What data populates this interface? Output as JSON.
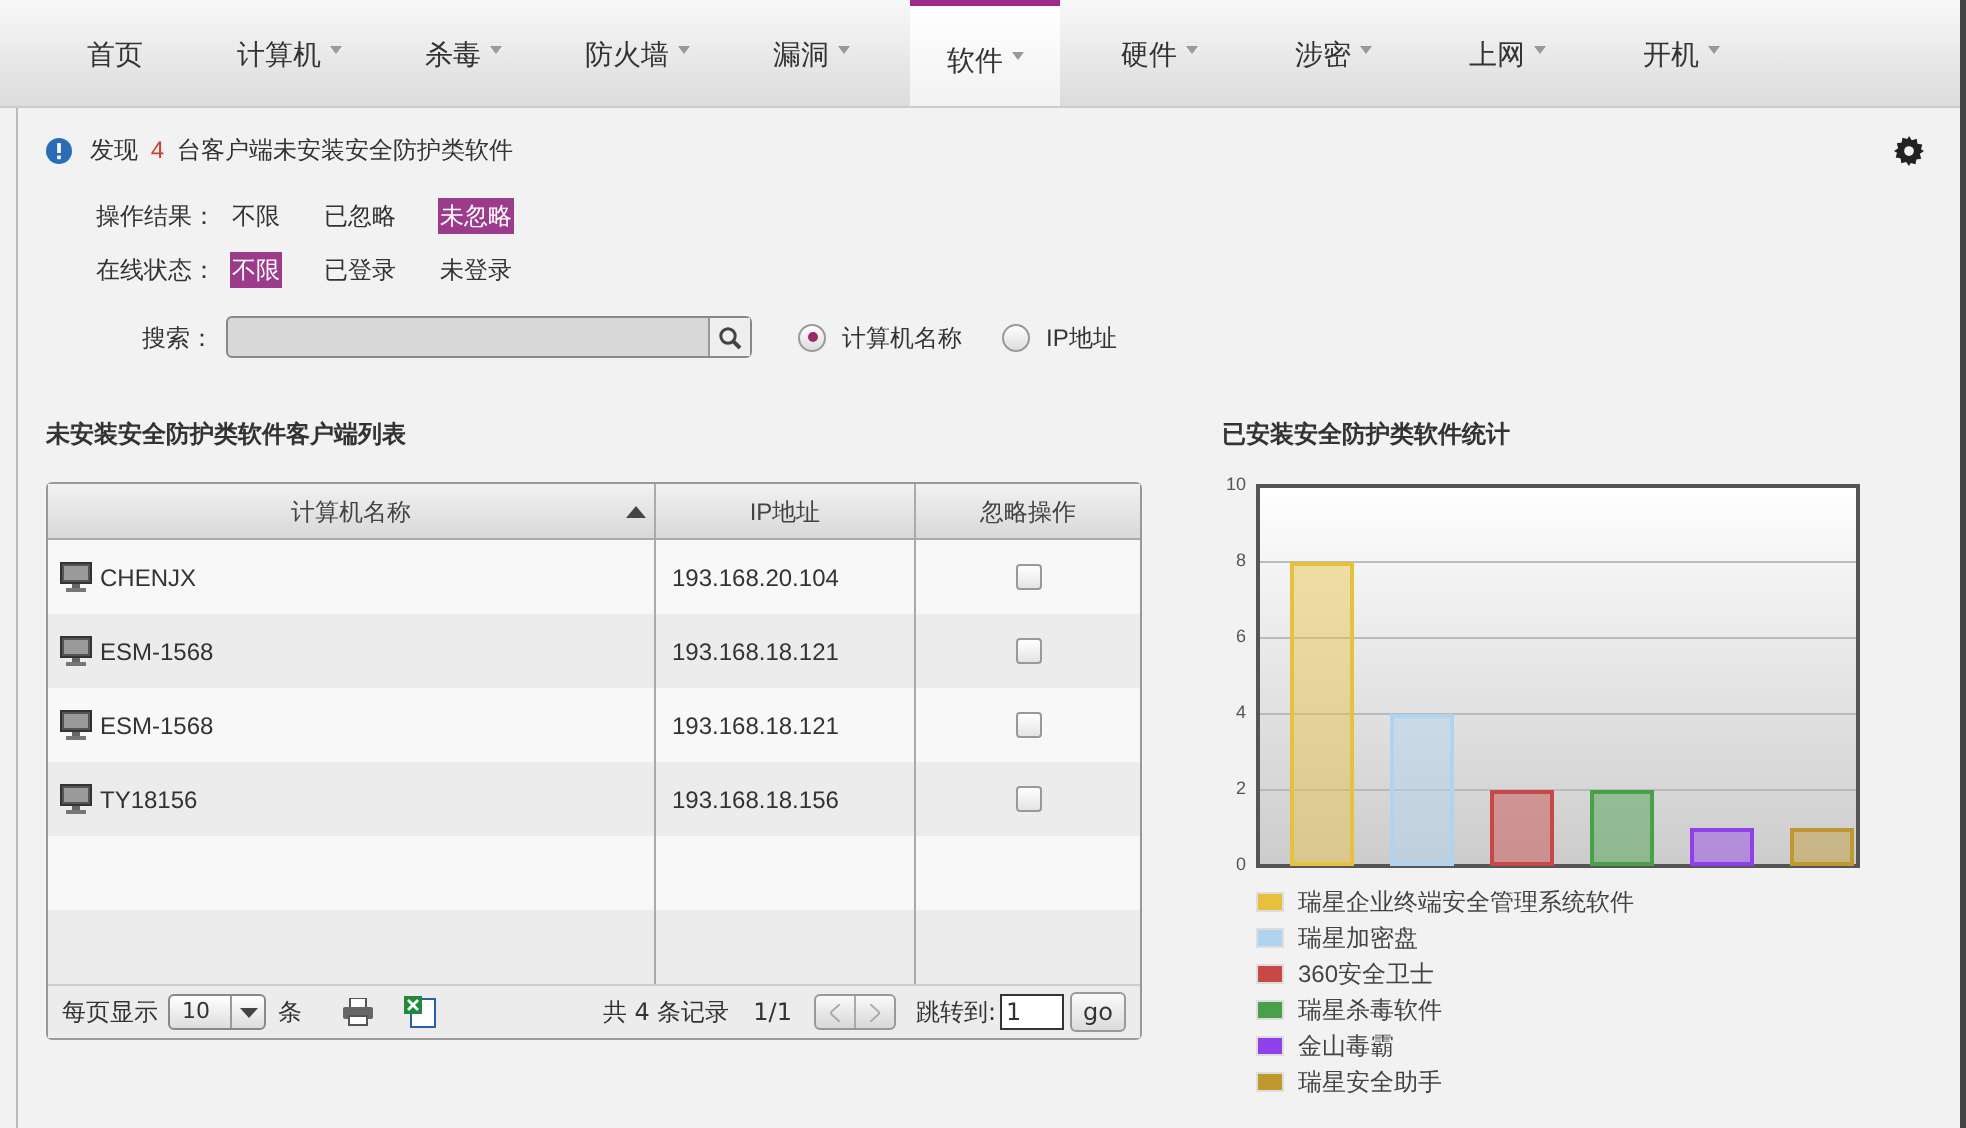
{
  "nav": [
    {
      "label": "首页",
      "dropdown": false,
      "selected": false
    },
    {
      "label": "计算机",
      "dropdown": true,
      "selected": false
    },
    {
      "label": "杀毒",
      "dropdown": true,
      "selected": false
    },
    {
      "label": "防火墙",
      "dropdown": true,
      "selected": false
    },
    {
      "label": "漏洞",
      "dropdown": true,
      "selected": false
    },
    {
      "label": "软件",
      "dropdown": true,
      "selected": true
    },
    {
      "label": "硬件",
      "dropdown": true,
      "selected": false
    },
    {
      "label": "涉密",
      "dropdown": true,
      "selected": false
    },
    {
      "label": "上网",
      "dropdown": true,
      "selected": false
    },
    {
      "label": "开机",
      "dropdown": true,
      "selected": false
    }
  ],
  "notice": {
    "prefix": "发现",
    "count": "4",
    "suffix": "台客户端未安装安全防护类软件"
  },
  "filters": [
    {
      "label": "操作结果：",
      "options": [
        {
          "label": "不限",
          "selected": false
        },
        {
          "label": "已忽略",
          "selected": false
        },
        {
          "label": "未忽略",
          "selected": true
        }
      ]
    },
    {
      "label": "在线状态：",
      "options": [
        {
          "label": "不限",
          "selected": true
        },
        {
          "label": "已登录",
          "selected": false
        },
        {
          "label": "未登录",
          "selected": false
        }
      ]
    }
  ],
  "search": {
    "label": "搜索：",
    "options": [
      {
        "label": "计算机名称",
        "selected": true
      },
      {
        "label": "IP地址",
        "selected": false
      }
    ]
  },
  "table": {
    "title": "未安装安全防护类软件客户端列表",
    "columns": [
      "计算机名称",
      "IP地址",
      "忽略操作"
    ],
    "rows": [
      {
        "name": "CHENJX",
        "ip": "193.168.20.104",
        "checked": false
      },
      {
        "name": "ESM-1568",
        "ip": "193.168.18.121",
        "checked": false
      },
      {
        "name": "ESM-1568",
        "ip": "193.168.18.121",
        "checked": false
      },
      {
        "name": "TY18156",
        "ip": "193.168.18.156",
        "checked": false
      }
    ],
    "footer": {
      "per_page_label": "每页显示",
      "per_page": "10",
      "unit": "条",
      "total": "共 4 条记录",
      "page": "1/1",
      "jump_label": "跳转到:",
      "jump_value": "1",
      "go": "go"
    }
  },
  "chart": {
    "chart_data": {
      "type": "bar",
      "title": "已安装安全防护类软件统计",
      "ylim": [
        0,
        10
      ],
      "grid": true,
      "legend": true,
      "yticks": [
        {
          "value": 0,
          "label": "0"
        },
        {
          "value": 2,
          "label": "2"
        },
        {
          "value": 4,
          "label": "4"
        },
        {
          "value": 6,
          "label": "6"
        },
        {
          "value": 8,
          "label": "8"
        },
        {
          "value": 10,
          "label": "10"
        }
      ],
      "series": [
        {
          "name": "瑞星企业终端安全管理系统软件",
          "color": "#e8c040",
          "values": [
            8
          ]
        },
        {
          "name": "瑞星加密盘",
          "color": "#b0d4f0",
          "values": [
            4
          ]
        },
        {
          "name": "360安全卫士",
          "color": "#c84848",
          "values": [
            2
          ]
        },
        {
          "name": "瑞星杀毒软件",
          "color": "#48a048",
          "values": [
            2
          ]
        },
        {
          "name": "金山毒霸",
          "color": "#9040e8",
          "values": [
            1
          ]
        },
        {
          "name": "瑞星安全助手",
          "color": "#c09830",
          "values": [
            1
          ]
        }
      ]
    }
  }
}
